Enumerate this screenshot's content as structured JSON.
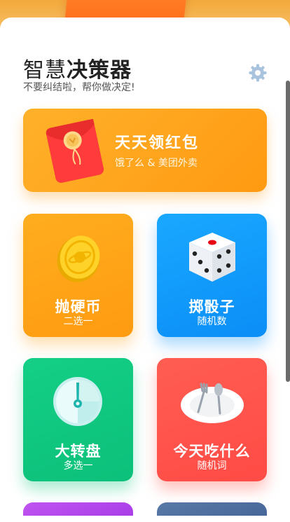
{
  "header": {
    "title_part1": "智慧",
    "title_part2": "决策器",
    "subtitle": "不要纠结啦，帮你做决定!"
  },
  "banner": {
    "title": "天天领红包",
    "subtitle": "饿了么 & 美团外卖"
  },
  "cards": [
    {
      "title": "抛硬币",
      "subtitle": "二选一",
      "color": "#ffa61a",
      "icon": "coin-icon"
    },
    {
      "title": "掷骰子",
      "subtitle": "随机数",
      "color": "#0f9cfb",
      "icon": "dice-icon"
    },
    {
      "title": "大转盘",
      "subtitle": "多选一",
      "color": "#10c882",
      "icon": "spin-wheel-icon"
    },
    {
      "title": "今天吃什么",
      "subtitle": "随机词",
      "color": "#ff544c",
      "icon": "plate-cutlery-icon"
    }
  ],
  "icons": {
    "settings": "gear-icon",
    "banner": "red-envelope-icon"
  },
  "colors": {
    "purple_card": "#b548ec",
    "slate_card": "#4f71a0"
  }
}
